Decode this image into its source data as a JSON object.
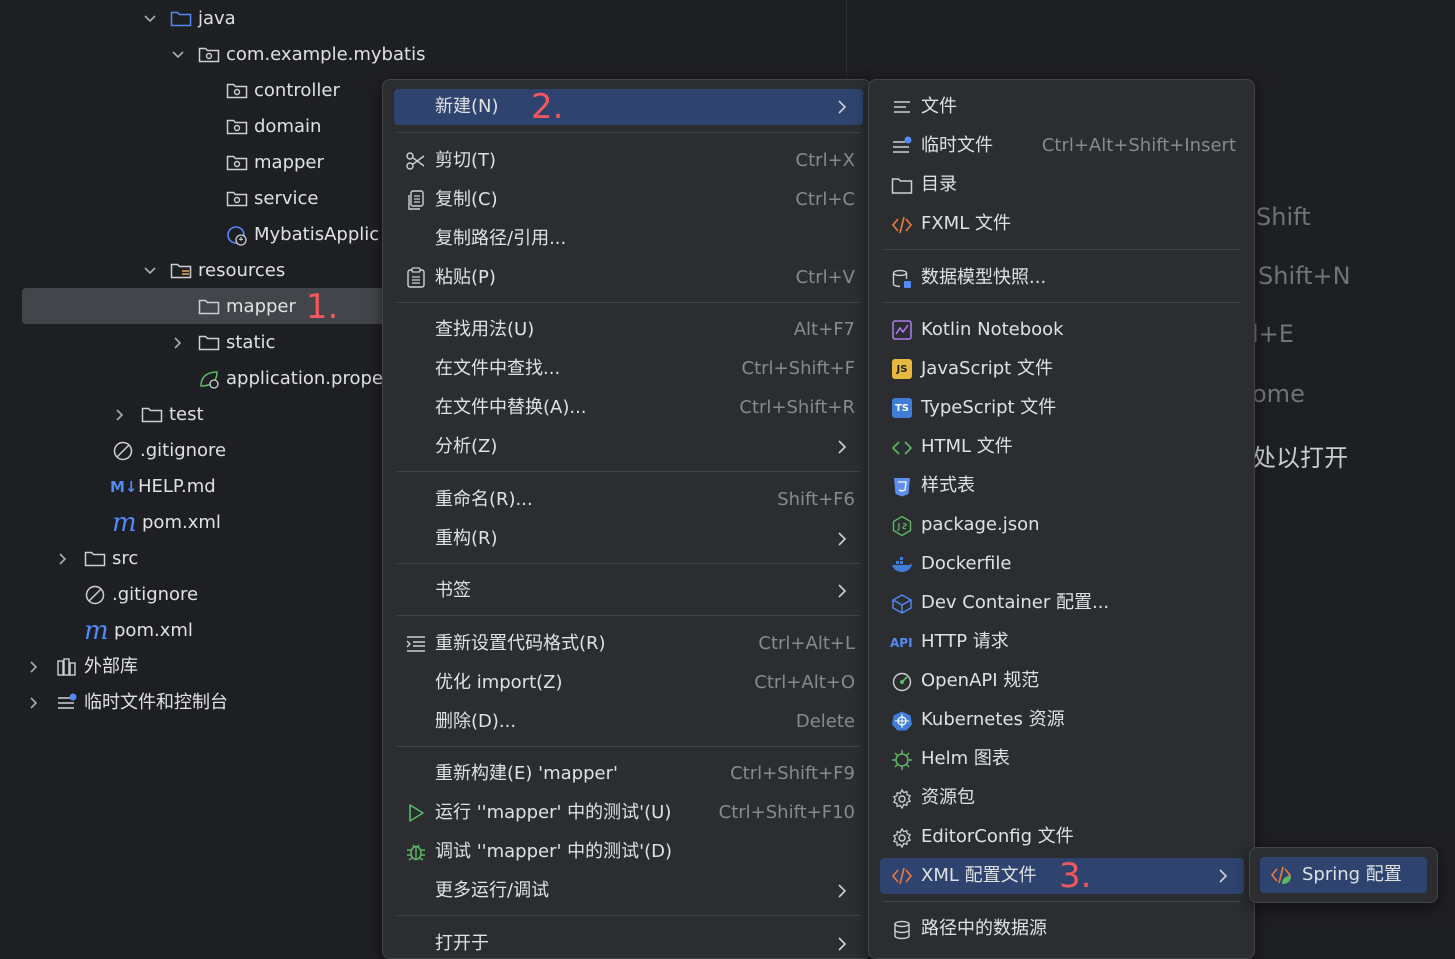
{
  "tree": {
    "items": [
      {
        "label": "java"
      },
      {
        "label": "com.example.mybatis"
      },
      {
        "label": "controller"
      },
      {
        "label": "domain"
      },
      {
        "label": "mapper"
      },
      {
        "label": "service"
      },
      {
        "label": "MybatisApplic"
      },
      {
        "label": "resources"
      },
      {
        "label": "mapper"
      },
      {
        "label": "static"
      },
      {
        "label": "application.proper"
      },
      {
        "label": "test"
      },
      {
        "label": ".gitignore"
      },
      {
        "label": "HELP.md"
      },
      {
        "label": "pom.xml"
      },
      {
        "label": "src"
      },
      {
        "label": ".gitignore"
      },
      {
        "label": "pom.xml"
      },
      {
        "label": "外部库"
      },
      {
        "label": "临时文件和控制台"
      }
    ],
    "step1": "1."
  },
  "editor_hints": [
    "Shift",
    "Shift+N",
    "l+E",
    "ome",
    "处以打开"
  ],
  "context_menu": {
    "new": {
      "label": "新建(N)",
      "step": "2."
    },
    "cut": {
      "label": "剪切(T)",
      "shortcut": "Ctrl+X"
    },
    "copy": {
      "label": "复制(C)",
      "shortcut": "Ctrl+C"
    },
    "copy_path": {
      "label": "复制路径/引用..."
    },
    "paste": {
      "label": "粘贴(P)",
      "shortcut": "Ctrl+V"
    },
    "find_usages": {
      "label": "查找用法(U)",
      "shortcut": "Alt+F7"
    },
    "find_in_files": {
      "label": "在文件中查找...",
      "shortcut": "Ctrl+Shift+F"
    },
    "replace_in_files": {
      "label": "在文件中替换(A)...",
      "shortcut": "Ctrl+Shift+R"
    },
    "analyze": {
      "label": "分析(Z)"
    },
    "rename": {
      "label": "重命名(R)...",
      "shortcut": "Shift+F6"
    },
    "refactor": {
      "label": "重构(R)"
    },
    "bookmarks": {
      "label": "书签"
    },
    "reformat": {
      "label": "重新设置代码格式(R)",
      "shortcut": "Ctrl+Alt+L"
    },
    "optimize_imports": {
      "label": "优化 import(Z)",
      "shortcut": "Ctrl+Alt+O"
    },
    "delete": {
      "label": "删除(D)...",
      "shortcut": "Delete"
    },
    "rebuild": {
      "label": "重新构建(E) 'mapper'",
      "shortcut": "Ctrl+Shift+F9"
    },
    "run_tests": {
      "label": "运行 ''mapper' 中的测试'(U)",
      "shortcut": "Ctrl+Shift+F10"
    },
    "debug_tests": {
      "label": "调试 ''mapper' 中的测试'(D)"
    },
    "more_run": {
      "label": "更多运行/调试"
    },
    "open_in": {
      "label": "打开于"
    }
  },
  "new_submenu": {
    "file": {
      "label": "文件"
    },
    "scratch": {
      "label": "临时文件",
      "shortcut": "Ctrl+Alt+Shift+Insert"
    },
    "directory": {
      "label": "目录"
    },
    "fxml": {
      "label": "FXML 文件"
    },
    "data_model": {
      "label": "数据模型快照..."
    },
    "kotlin_nb": {
      "label": "Kotlin Notebook"
    },
    "js": {
      "label": "JavaScript 文件"
    },
    "ts": {
      "label": "TypeScript 文件"
    },
    "html": {
      "label": "HTML 文件"
    },
    "stylesheet": {
      "label": "样式表"
    },
    "package_json": {
      "label": "package.json"
    },
    "dockerfile": {
      "label": "Dockerfile"
    },
    "dev_container": {
      "label": "Dev Container 配置..."
    },
    "http": {
      "label": "HTTP 请求"
    },
    "openapi": {
      "label": "OpenAPI 规范"
    },
    "k8s": {
      "label": "Kubernetes 资源"
    },
    "helm": {
      "label": "Helm 图表"
    },
    "resource_bundle": {
      "label": "资源包"
    },
    "editorconfig": {
      "label": "EditorConfig 文件"
    },
    "xml_config": {
      "label": "XML 配置文件",
      "step": "3."
    },
    "datasource": {
      "label": "路径中的数据源"
    }
  },
  "xml_submenu": {
    "spring": {
      "label": "Spring 配置"
    }
  },
  "icon_text": {
    "js": "JS",
    "ts": "TS",
    "api": "API",
    "md": "M↓",
    "pom": "m"
  },
  "colors": {
    "accent": "#2e436e",
    "step": "#f0575e",
    "bg": "#1e1f22",
    "menu": "#2b2d30"
  }
}
